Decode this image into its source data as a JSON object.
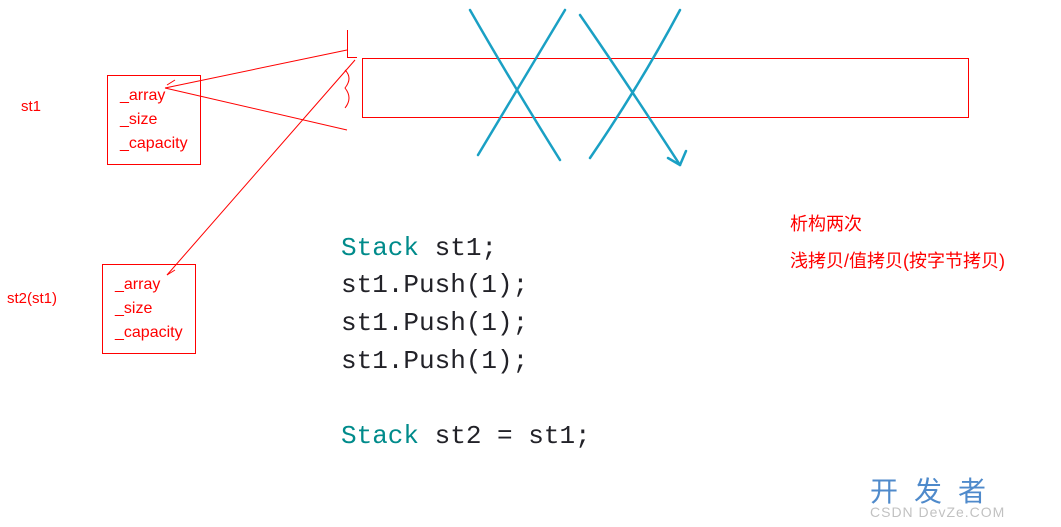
{
  "struct1": {
    "label": "st1",
    "fields": [
      "_array",
      "_size",
      "_capacity"
    ]
  },
  "struct2": {
    "label": "st2(st1)",
    "fields": [
      "_array",
      "_size",
      "_capacity"
    ]
  },
  "code": {
    "line1": {
      "type": "Stack",
      "rest": " st1;"
    },
    "line2": "st1.Push(1);",
    "line3": "st1.Push(1);",
    "line4": "st1.Push(1);",
    "line5": {
      "type": "Stack",
      "rest": " st2 = st1;"
    }
  },
  "annotation": {
    "line1": "析构两次",
    "line2": "浅拷贝/值拷贝(按字节拷贝)"
  },
  "watermark": {
    "main": "开发者",
    "sub": "CSDN DevZe.COM"
  },
  "chart_data": {
    "type": "diagram",
    "description": "Two stack objects st1 and st2 share the same underlying _array pointer after shallow copy, leading to double destruction",
    "objects": [
      {
        "name": "st1",
        "members": [
          "_array",
          "_size",
          "_capacity"
        ],
        "array_ptr_target": "shared_heap_array"
      },
      {
        "name": "st2",
        "copied_from": "st1",
        "members": [
          "_array",
          "_size",
          "_capacity"
        ],
        "array_ptr_target": "shared_heap_array"
      }
    ],
    "heap": {
      "id": "shared_heap_array",
      "representation": "long rectangle",
      "marked": "crossed out (blue X marks)"
    },
    "code_sequence": [
      "Stack st1;",
      "st1.Push(1);",
      "st1.Push(1);",
      "st1.Push(1);",
      "Stack st2 = st1;"
    ],
    "notes": [
      "析构两次",
      "浅拷贝/值拷贝(按字节拷贝)"
    ]
  }
}
